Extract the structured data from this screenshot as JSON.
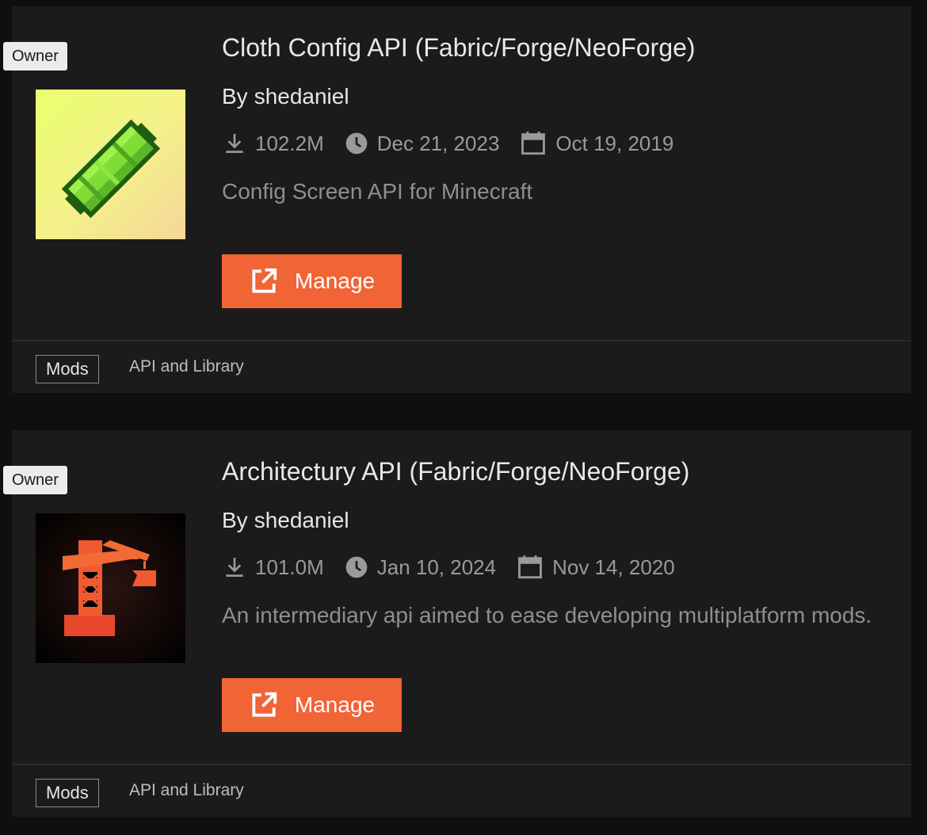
{
  "mods": [
    {
      "owner_badge": "Owner",
      "title": "Cloth Config API (Fabric/Forge/NeoForge)",
      "by_label": "By",
      "author": "shedaniel",
      "downloads": "102.2M",
      "updated": "Dec 21, 2023",
      "created": "Oct 19, 2019",
      "description": "Config Screen API for Minecraft",
      "manage_label": "Manage",
      "type_tag": "Mods",
      "category": "API and Library",
      "icon": "cloth-config-logo"
    },
    {
      "owner_badge": "Owner",
      "title": "Architectury API (Fabric/Forge/NeoForge)",
      "by_label": "By",
      "author": "shedaniel",
      "downloads": "101.0M",
      "updated": "Jan 10, 2024",
      "created": "Nov 14, 2020",
      "description": "An intermediary api aimed to ease developing multiplatform mods.",
      "manage_label": "Manage",
      "type_tag": "Mods",
      "category": "API and Library",
      "icon": "architectury-crane-logo"
    }
  ],
  "colors": {
    "accent": "#f16436",
    "card_bg": "#1b1b1b",
    "page_bg": "#0f0f0f"
  }
}
